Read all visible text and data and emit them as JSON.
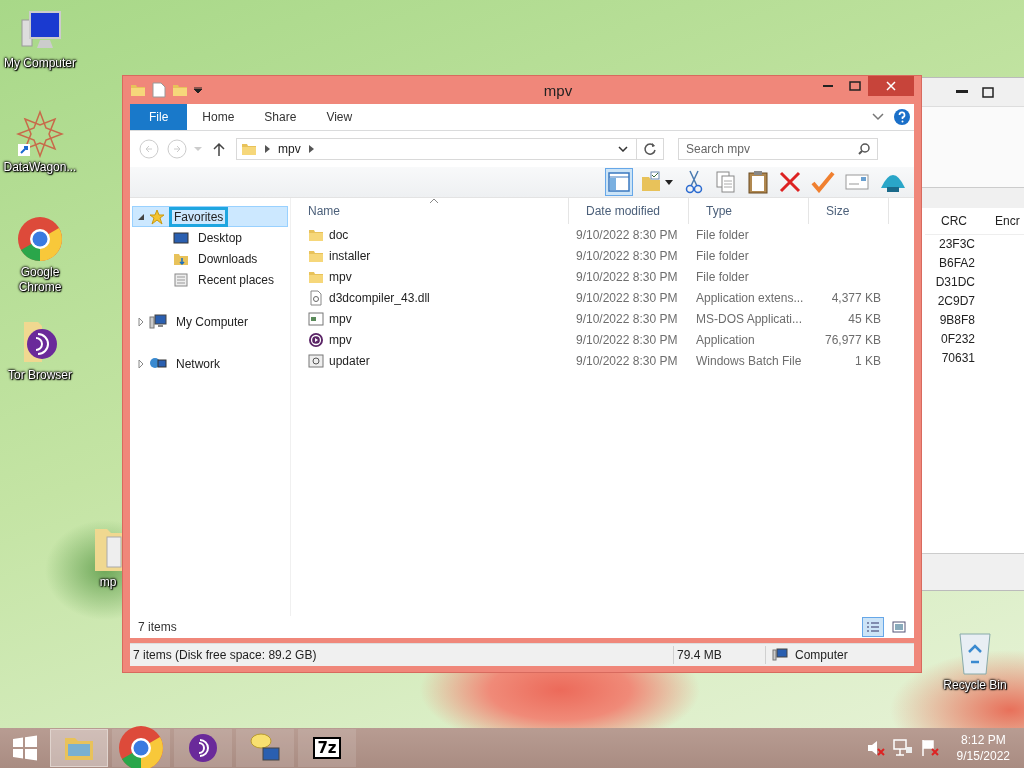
{
  "desktop_icons": [
    {
      "kind": "computer",
      "label": "My Computer"
    },
    {
      "kind": "star",
      "label": "DataWagon..."
    },
    {
      "kind": "chrome",
      "label": "Google Chrome"
    },
    {
      "kind": "tor",
      "label": "Tor Browser"
    },
    {
      "kind": "folder",
      "label": "mp"
    },
    {
      "kind": "recycle",
      "label": "Recycle Bin"
    }
  ],
  "background_window": {
    "columns": [
      "CRC",
      "Encr"
    ],
    "crc_values": [
      "23F3C",
      "B6FA2",
      "D31DC",
      "2C9D7",
      "9B8F8",
      "0F232",
      "70631"
    ]
  },
  "window": {
    "title": "mpv",
    "ribbon_tabs": [
      {
        "label": "File",
        "kind": "file",
        "selected": false
      },
      {
        "label": "Home",
        "kind": "tab",
        "selected": false
      },
      {
        "label": "Share",
        "kind": "tab",
        "selected": false
      },
      {
        "label": "View",
        "kind": "tab",
        "selected": false
      }
    ],
    "address": {
      "breadcrumb": [
        "mpv"
      ]
    },
    "search": {
      "placeholder": "Search mpv"
    },
    "toolbar": [
      {
        "kind": "preview",
        "selected": true
      },
      {
        "kind": "properties",
        "selected": false
      },
      {
        "kind": "cut",
        "selected": false
      },
      {
        "kind": "copy",
        "selected": false
      },
      {
        "kind": "paste",
        "selected": false
      },
      {
        "kind": "delete",
        "selected": false
      },
      {
        "kind": "rename",
        "selected": false
      },
      {
        "kind": "mail",
        "selected": false
      },
      {
        "kind": "shell",
        "selected": false
      }
    ],
    "nav_tree": [
      {
        "label": "Favorites",
        "kind": "star",
        "expanded": true,
        "selected": true,
        "children": [
          {
            "label": "Desktop",
            "kind": "desktop",
            "selected": false
          },
          {
            "label": "Downloads",
            "kind": "downloads",
            "selected": false
          },
          {
            "label": "Recent places",
            "kind": "recent",
            "selected": false
          }
        ]
      },
      {
        "label": "My Computer",
        "kind": "computer",
        "expanded": false,
        "selected": false
      },
      {
        "label": "Network",
        "kind": "network",
        "expanded": false,
        "selected": false
      }
    ],
    "columns": [
      {
        "label": "Name",
        "sorted": true
      },
      {
        "label": "Date modified",
        "sorted": false
      },
      {
        "label": "Type",
        "sorted": false
      },
      {
        "label": "Size",
        "sorted": false
      }
    ],
    "rows": [
      {
        "kind": "folder",
        "name": "doc",
        "date": "9/10/2022 8:30 PM",
        "type": "File folder"
      },
      {
        "kind": "folder",
        "name": "installer",
        "date": "9/10/2022 8:30 PM",
        "type": "File folder"
      },
      {
        "kind": "folder",
        "name": "mpv",
        "date": "9/10/2022 8:30 PM",
        "type": "File folder"
      },
      {
        "kind": "dll",
        "name": "d3dcompiler_43.dll",
        "date": "9/10/2022 8:30 PM",
        "type": "Application extens...",
        "size": "4,377 KB"
      },
      {
        "kind": "console",
        "name": "mpv",
        "date": "9/10/2022 8:30 PM",
        "type": "MS-DOS Applicati...",
        "size": "45 KB"
      },
      {
        "kind": "app",
        "name": "mpv",
        "date": "9/10/2022 8:30 PM",
        "type": "Application",
        "size": "76,977 KB"
      },
      {
        "kind": "batch",
        "name": "updater",
        "date": "9/10/2022 8:30 PM",
        "type": "Windows Batch File",
        "size": "1 KB"
      }
    ],
    "item_count": "7 items",
    "view_buttons": [
      {
        "kind": "details",
        "selected": true
      },
      {
        "kind": "large",
        "selected": false
      }
    ],
    "status_bar": {
      "items": "7 items (Disk free space: 89.2 GB)",
      "size": "79.4 MB",
      "location": "Computer"
    }
  },
  "taskbar": {
    "apps": [
      {
        "kind": "explorer",
        "selected": true
      },
      {
        "kind": "chrome",
        "selected": false
      },
      {
        "kind": "tor",
        "selected": false
      },
      {
        "kind": "chat",
        "selected": false
      },
      {
        "kind": "sevenzip",
        "label": "7z",
        "selected": false
      }
    ],
    "tray": [
      {
        "kind": "speaker"
      },
      {
        "kind": "network"
      },
      {
        "kind": "flag"
      }
    ],
    "clock": {
      "time": "8:12 PM",
      "date": "9/15/2022"
    }
  }
}
